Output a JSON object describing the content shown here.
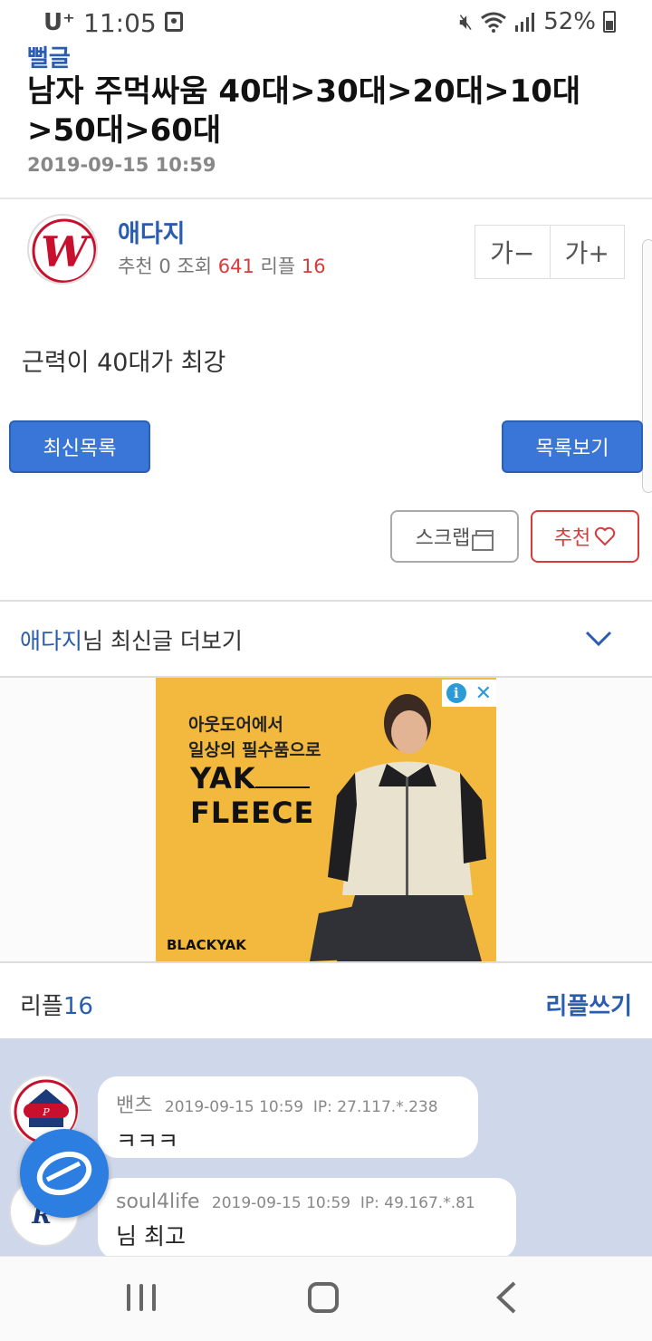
{
  "status_bar": {
    "carrier": "U⁺",
    "time": "11:05",
    "battery": "52%",
    "icons": [
      "media-icon",
      "mute-icon",
      "wifi-icon",
      "signal-icon",
      "battery-icon"
    ]
  },
  "post": {
    "board": "뻘글",
    "title": "남자 주먹싸움 40대>30대>20대>10대>50대>60대",
    "date": "2019-09-15 10:59",
    "author": "애다지",
    "rec_label": "추천",
    "rec_value": "0",
    "views_label": "조회",
    "views_value": "641",
    "replies_label": "리플",
    "replies_value": "16",
    "body": "근력이 40대가 최강"
  },
  "font_controls": {
    "decrease": "가−",
    "increase": "가+"
  },
  "actions": {
    "latest_list": "최신목록",
    "view_list": "목록보기",
    "scrap": "스크랩",
    "recommend": "추천"
  },
  "more_posts": {
    "author": "애다지",
    "suffix": "님 최신글 더보기"
  },
  "ad": {
    "line1": "아웃도어에서",
    "line2": "일상의 필수품으로",
    "brand_line1": "YAK",
    "brand_line2": "FLEECE",
    "logo": "BLACKYAK",
    "info": "i",
    "close": "✕"
  },
  "replies": {
    "label": "리플",
    "count": "16",
    "write": "리플쓰기",
    "items": [
      {
        "nick": "밴츠",
        "time": "2019-09-15 10:59",
        "ip": "IP: 27.117.*.238",
        "text": "ㅋㅋㅋ"
      },
      {
        "nick": "soul4life",
        "time": "2019-09-15 10:59",
        "ip": "IP: 49.167.*.81",
        "text": "님 최고"
      }
    ]
  },
  "colors": {
    "accent": "#2a5db0",
    "button_blue": "#3a75d8",
    "red": "#d93b3b",
    "comment_bg": "#cfd8ea",
    "ad_bg": "#f3b93f"
  }
}
